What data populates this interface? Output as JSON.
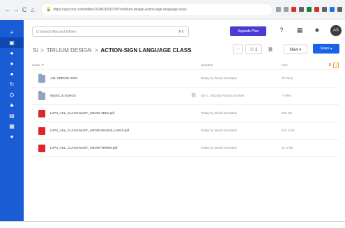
{
  "browser": {
    "back": "←",
    "forward": "→",
    "reload": "C",
    "home": "⌂",
    "url": "https://app.box.com/folder/163419926739?s=trilium-design-action-sign-language-class"
  },
  "rail": {
    "items": [
      "≡",
      "▣",
      "●",
      "●",
      "●",
      "↻",
      "⛭",
      "♣",
      "▤",
      "▦",
      "●"
    ]
  },
  "topbar": {
    "search_placeholder": "Q  Search files and folders",
    "search_shortcut": "⌘K",
    "upgrade_label": "Upgrade Plan",
    "help_icon": "?",
    "apps_icon": "▦",
    "notifications_icon": "♣",
    "avatar_initials": "AS"
  },
  "breadcrumb": {
    "root": "Si",
    "parent": "TRILIUM DESIGN",
    "current": "ACTION-SIGN LANGUAGE CLASS"
  },
  "actions": {
    "more": "···",
    "members": "⚇ 1",
    "link": "⛓",
    "new_label": "New ▾",
    "share_label": "Share ▴"
  },
  "table": {
    "headers": {
      "name": "Name ▼",
      "activity": "Updated",
      "size": "Size"
    },
    "rows": [
      {
        "type": "folder",
        "name": "ASL SPRING 2022",
        "activity": "Today by David Gonzalez",
        "size": "37 Files",
        "linked": false
      },
      {
        "type": "folder",
        "name": "MUSIC & SONGS",
        "activity": "Apr 1, 2022 by Antonio Gomez",
        "size": "7 Files",
        "linked": true
      },
      {
        "type": "pdf",
        "name": "LVP3_ASL_CLASS-MUST_KNOW-ABCs.pdf",
        "activity": "Today by David Gonzalez",
        "size": "223 KB",
        "linked": false
      },
      {
        "type": "pdf",
        "name": "LVP3_ASL_CLASS-MUST_KNOW-ONLINE_LINKS.pdf",
        "activity": "Today by David Gonzalez",
        "size": "211.4 KB",
        "linked": false
      },
      {
        "type": "pdf",
        "name": "LVP3_ASL_CLASS-MUST_KNOW-TERMS.pdf",
        "activity": "Today by David Gonzalez",
        "size": "61.4 KB",
        "linked": false
      }
    ]
  },
  "view": {
    "list_icon": "≡",
    "grid_icon": "◂"
  },
  "colors": {
    "rail": "#1a5bd6",
    "upgrade": "#4a3bd4",
    "share": "#1a62e8",
    "pdf": "#e0262a",
    "folder": "#8da4c2"
  }
}
